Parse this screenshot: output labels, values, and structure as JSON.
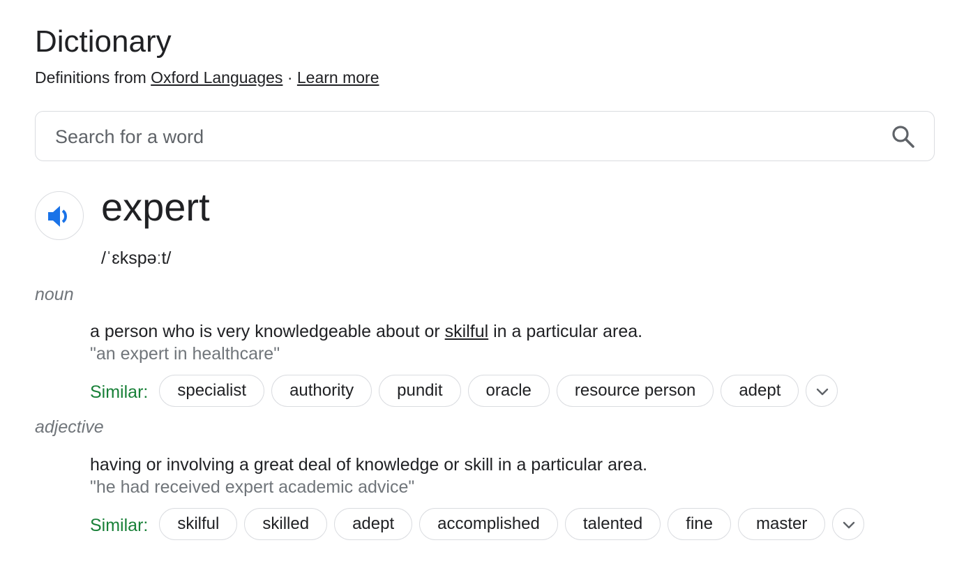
{
  "header": {
    "title": "Dictionary",
    "source_prefix": "Definitions from",
    "source_link": "Oxford Languages",
    "separator": "·",
    "learn_more": "Learn more"
  },
  "search": {
    "placeholder": "Search for a word",
    "value": "",
    "icon": "search-icon"
  },
  "entry": {
    "word": "expert",
    "phonetic": "/ˈɛkspəːt/",
    "audio_icon": "speaker-icon",
    "senses": [
      {
        "pos": "noun",
        "definition_before": "a person who is very knowledgeable about or ",
        "definition_link": "skilful",
        "definition_after": " in a particular area.",
        "example": "\"an expert in healthcare\"",
        "similar_label": "Similar:",
        "similar": [
          "specialist",
          "authority",
          "pundit",
          "oracle",
          "resource person",
          "adept"
        ]
      },
      {
        "pos": "adjective",
        "definition": "having or involving a great deal of knowledge or skill in a particular area.",
        "example": "\"he had received expert academic advice\"",
        "similar_label": "Similar:",
        "similar": [
          "skilful",
          "skilled",
          "adept",
          "accomplished",
          "talented",
          "fine",
          "master"
        ]
      }
    ]
  },
  "colors": {
    "text": "#202124",
    "muted": "#70757a",
    "similar_green": "#188038",
    "speaker_blue": "#1a73e8",
    "border": "#dadce0"
  }
}
